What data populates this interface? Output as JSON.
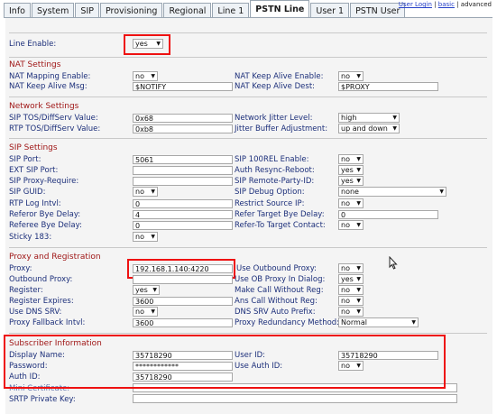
{
  "tabs": [
    "Info",
    "System",
    "SIP",
    "Provisioning",
    "Regional",
    "Line 1",
    "PSTN Line",
    "User 1",
    "PSTN User"
  ],
  "top_links": {
    "user_login": "User Login",
    "basic": "basic",
    "sep": "|",
    "advanced": "advanced"
  },
  "line_enable": {
    "label": "Line Enable:",
    "value": "yes"
  },
  "nat": {
    "title": "NAT Settings",
    "mapping_label": "NAT Mapping Enable:",
    "mapping_value": "no",
    "keepalive_enable_label": "NAT Keep Alive Enable:",
    "keepalive_enable_value": "no",
    "keepalive_msg_label": "NAT Keep Alive Msg:",
    "keepalive_msg_value": "$NOTIFY",
    "keepalive_dest_label": "NAT Keep Alive Dest:",
    "keepalive_dest_value": "$PROXY"
  },
  "network": {
    "title": "Network Settings",
    "sip_tos_label": "SIP TOS/DiffServ Value:",
    "sip_tos_value": "0x68",
    "jitter_level_label": "Network Jitter Level:",
    "jitter_level_value": "high",
    "rtp_tos_label": "RTP TOS/DiffServ Value:",
    "rtp_tos_value": "0xb8",
    "jitter_adj_label": "Jitter Buffer Adjustment:",
    "jitter_adj_value": "up and down"
  },
  "sip": {
    "title": "SIP Settings",
    "port_label": "SIP Port:",
    "port_value": "5061",
    "rel100_label": "SIP 100REL Enable:",
    "rel100_value": "no",
    "ext_port_label": "EXT SIP Port:",
    "ext_port_value": "",
    "auth_resync_label": "Auth Resync-Reboot:",
    "auth_resync_value": "yes",
    "proxy_require_label": "SIP Proxy-Require:",
    "proxy_require_value": "",
    "remote_party_label": "SIP Remote-Party-ID:",
    "remote_party_value": "yes",
    "guid_label": "SIP GUID:",
    "guid_value": "no",
    "debug_label": "SIP Debug Option:",
    "debug_value": "none",
    "rtp_log_label": "RTP Log Intvl:",
    "rtp_log_value": "0",
    "restrict_label": "Restrict Source IP:",
    "restrict_value": "no",
    "referor_label": "Referor Bye Delay:",
    "referor_value": "4",
    "refer_target_label": "Refer Target Bye Delay:",
    "refer_target_value": "0",
    "referee_label": "Referee Bye Delay:",
    "referee_value": "0",
    "refer_to_label": "Refer-To Target Contact:",
    "refer_to_value": "no",
    "sticky_label": "Sticky 183:",
    "sticky_value": "no"
  },
  "proxy": {
    "title": "Proxy and Registration",
    "proxy_label": "Proxy:",
    "proxy_value": "192.168.1.140:4220",
    "use_outbound_label": "Use Outbound Proxy:",
    "use_outbound_value": "no",
    "outbound_label": "Outbound Proxy:",
    "outbound_value": "",
    "ob_dialog_label": "Use OB Proxy In Dialog:",
    "ob_dialog_value": "yes",
    "register_label": "Register:",
    "register_value": "yes",
    "call_wo_reg_label": "Make Call Without Reg:",
    "call_wo_reg_value": "no",
    "expires_label": "Register Expires:",
    "expires_value": "3600",
    "ans_wo_reg_label": "Ans Call Without Reg:",
    "ans_wo_reg_value": "no",
    "dns_srv_label": "Use DNS SRV:",
    "dns_srv_value": "no",
    "dns_prefix_label": "DNS SRV Auto Prefix:",
    "dns_prefix_value": "no",
    "fallback_label": "Proxy Fallback Intvl:",
    "fallback_value": "3600",
    "redundancy_label": "Proxy Redundancy Method:",
    "redundancy_value": "Normal"
  },
  "subscriber": {
    "title": "Subscriber Information",
    "display_label": "Display Name:",
    "display_value": "35718290",
    "user_id_label": "User ID:",
    "user_id_value": "35718290",
    "password_label": "Password:",
    "password_value": "************",
    "use_auth_label": "Use Auth ID:",
    "use_auth_value": "no",
    "auth_id_label": "Auth ID:",
    "auth_id_value": "35718290",
    "mini_cert_label": "Mini Certificate:",
    "mini_cert_value": "",
    "srtp_label": "SRTP Private Key:",
    "srtp_value": ""
  },
  "colors": {
    "section_title": "#a01818",
    "label": "#1c2f7a",
    "highlight": "#e11111",
    "background": "#f4f4f4"
  }
}
